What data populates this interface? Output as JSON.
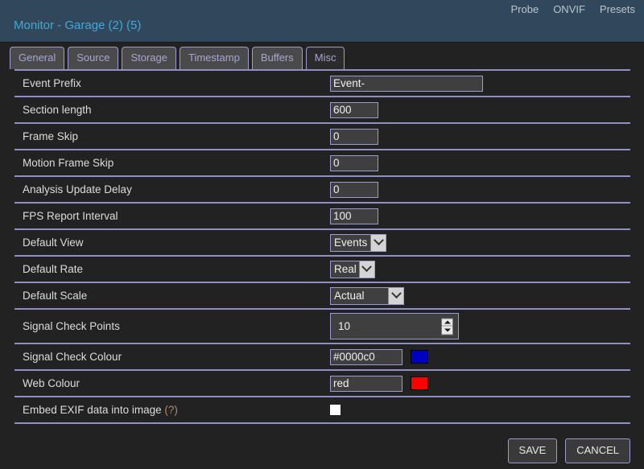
{
  "header": {
    "title": "Monitor - Garage (2) (5)",
    "links": [
      {
        "label": "Probe",
        "name": "probe-link"
      },
      {
        "label": "ONVIF",
        "name": "onvif-link"
      },
      {
        "label": "Presets",
        "name": "presets-link"
      }
    ]
  },
  "tabs": [
    {
      "label": "General",
      "active": false
    },
    {
      "label": "Source",
      "active": false
    },
    {
      "label": "Storage",
      "active": false
    },
    {
      "label": "Timestamp",
      "active": false
    },
    {
      "label": "Buffers",
      "active": false
    },
    {
      "label": "Misc",
      "active": true
    }
  ],
  "form": {
    "event_prefix": {
      "label": "Event Prefix",
      "value": "Event-"
    },
    "section_length": {
      "label": "Section length",
      "value": "600"
    },
    "frame_skip": {
      "label": "Frame Skip",
      "value": "0"
    },
    "motion_frame_skip": {
      "label": "Motion Frame Skip",
      "value": "0"
    },
    "analysis_update_delay": {
      "label": "Analysis Update Delay",
      "value": "0"
    },
    "fps_report_interval": {
      "label": "FPS Report Interval",
      "value": "100"
    },
    "default_view": {
      "label": "Default View",
      "value": "Events"
    },
    "default_rate": {
      "label": "Default Rate",
      "value": "Real"
    },
    "default_scale": {
      "label": "Default Scale",
      "value": "Actual"
    },
    "signal_check_points": {
      "label": "Signal Check Points",
      "value": "10"
    },
    "signal_check_colour": {
      "label": "Signal Check Colour",
      "value": "#0000c0",
      "swatch": "#0000c0"
    },
    "web_colour": {
      "label": "Web Colour",
      "value": "red",
      "swatch": "#ff0000"
    },
    "embed_exif": {
      "label": "Embed EXIF data into image ",
      "help": "(?)",
      "checked": false
    }
  },
  "footer": {
    "save_label": "SAVE",
    "cancel_label": "CANCEL"
  }
}
